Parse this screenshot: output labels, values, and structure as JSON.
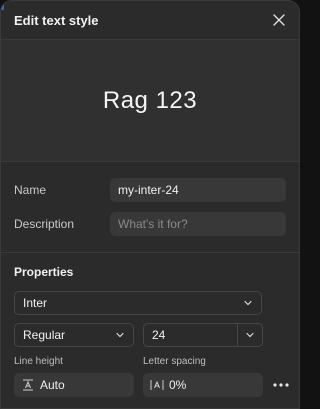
{
  "dialog": {
    "title": "Edit text style",
    "preview_text": "Rag 123"
  },
  "fields": {
    "name_label": "Name",
    "name_value": "my-inter-24",
    "description_label": "Description",
    "description_placeholder": "What's it for?"
  },
  "properties": {
    "title": "Properties",
    "font_family": "Inter",
    "font_weight": "Regular",
    "font_size": "24",
    "line_height_label": "Line height",
    "line_height_value": "Auto",
    "letter_spacing_label": "Letter spacing",
    "letter_spacing_value": "0%"
  },
  "icons": {
    "close": "close-icon",
    "chevron": "chevron-down-icon",
    "line_height": "line-height-icon",
    "letter_spacing": "letter-spacing-icon",
    "more": "more-options-icon"
  },
  "colors": {
    "panel_bg": "#2b2b2b",
    "preview_bg": "#303030",
    "field_bg": "#383838",
    "accent_edge": "#2f6fe0"
  }
}
